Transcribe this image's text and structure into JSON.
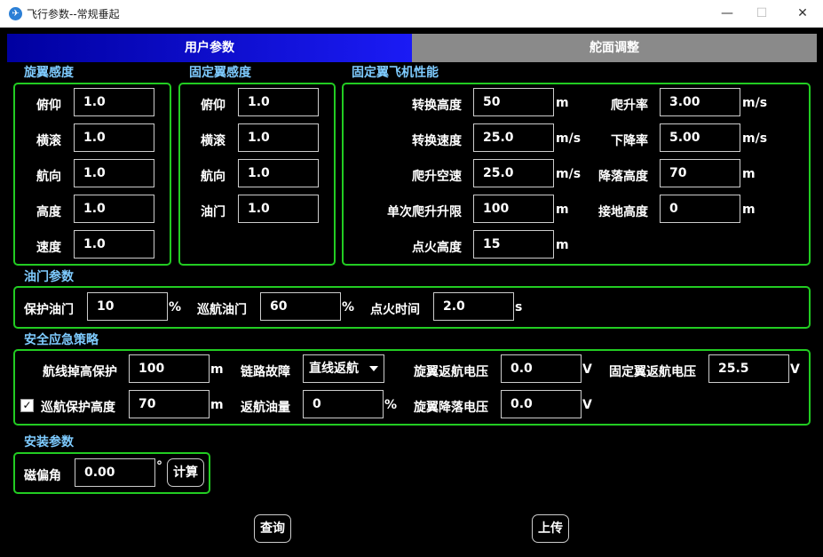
{
  "window": {
    "title": "飞行参数--常规垂起",
    "min": "—",
    "max": "☐",
    "close": "✕"
  },
  "tabs": {
    "user": "用户参数",
    "surface": "舵面调整"
  },
  "rotor": {
    "title": "旋翼感度",
    "items": [
      {
        "label": "俯仰",
        "value": "1.0"
      },
      {
        "label": "横滚",
        "value": "1.0"
      },
      {
        "label": "航向",
        "value": "1.0"
      },
      {
        "label": "高度",
        "value": "1.0"
      },
      {
        "label": "速度",
        "value": "1.0"
      }
    ]
  },
  "fixed": {
    "title": "固定翼感度",
    "items": [
      {
        "label": "俯仰",
        "value": "1.0"
      },
      {
        "label": "横滚",
        "value": "1.0"
      },
      {
        "label": "航向",
        "value": "1.0"
      },
      {
        "label": "油门",
        "value": "1.0"
      }
    ]
  },
  "perf": {
    "title": "固定翼飞机性能",
    "left": [
      {
        "label": "转换高度",
        "value": "50",
        "unit": "m"
      },
      {
        "label": "转换速度",
        "value": "25.0",
        "unit": "m/s"
      },
      {
        "label": "爬升空速",
        "value": "25.0",
        "unit": "m/s"
      },
      {
        "label": "单次爬升升限",
        "value": "100",
        "unit": "m"
      },
      {
        "label": "点火高度",
        "value": "15",
        "unit": "m"
      }
    ],
    "right": [
      {
        "label": "爬升率",
        "value": "3.00",
        "unit": "m/s"
      },
      {
        "label": "下降率",
        "value": "5.00",
        "unit": "m/s"
      },
      {
        "label": "降落高度",
        "value": "70",
        "unit": "m"
      },
      {
        "label": "接地高度",
        "value": "0",
        "unit": "m"
      }
    ]
  },
  "throttle": {
    "title": "油门参数",
    "protect": {
      "label": "保护油门",
      "value": "10",
      "unit": "%"
    },
    "cruise": {
      "label": "巡航油门",
      "value": "60",
      "unit": "%"
    },
    "ignite": {
      "label": "点火时间",
      "value": "2.0",
      "unit": "s"
    }
  },
  "safety": {
    "title": "安全应急策略",
    "route_drop": {
      "label": "航线掉高保护",
      "value": "100",
      "unit": "m"
    },
    "link_fail": {
      "label": "链路故障",
      "value": "直线返航"
    },
    "rotor_rtl_volt": {
      "label": "旋翼返航电压",
      "value": "0.0",
      "unit": "V"
    },
    "fixed_rtl_volt": {
      "label": "固定翼返航电压",
      "value": "25.5",
      "unit": "V"
    },
    "cruise_protect": {
      "label": "巡航保护高度",
      "value": "70",
      "unit": "m",
      "checked": true,
      "check": "✓"
    },
    "rtl_fuel": {
      "label": "返航油量",
      "value": "0",
      "unit": "%"
    },
    "rotor_land_volt": {
      "label": "旋翼降落电压",
      "value": "0.0",
      "unit": "V"
    }
  },
  "install": {
    "title": "安装参数",
    "mag": {
      "label": "磁偏角",
      "value": "0.00",
      "unit": "°"
    },
    "calc": "计算"
  },
  "footer": {
    "query": "查询",
    "upload": "上传"
  }
}
